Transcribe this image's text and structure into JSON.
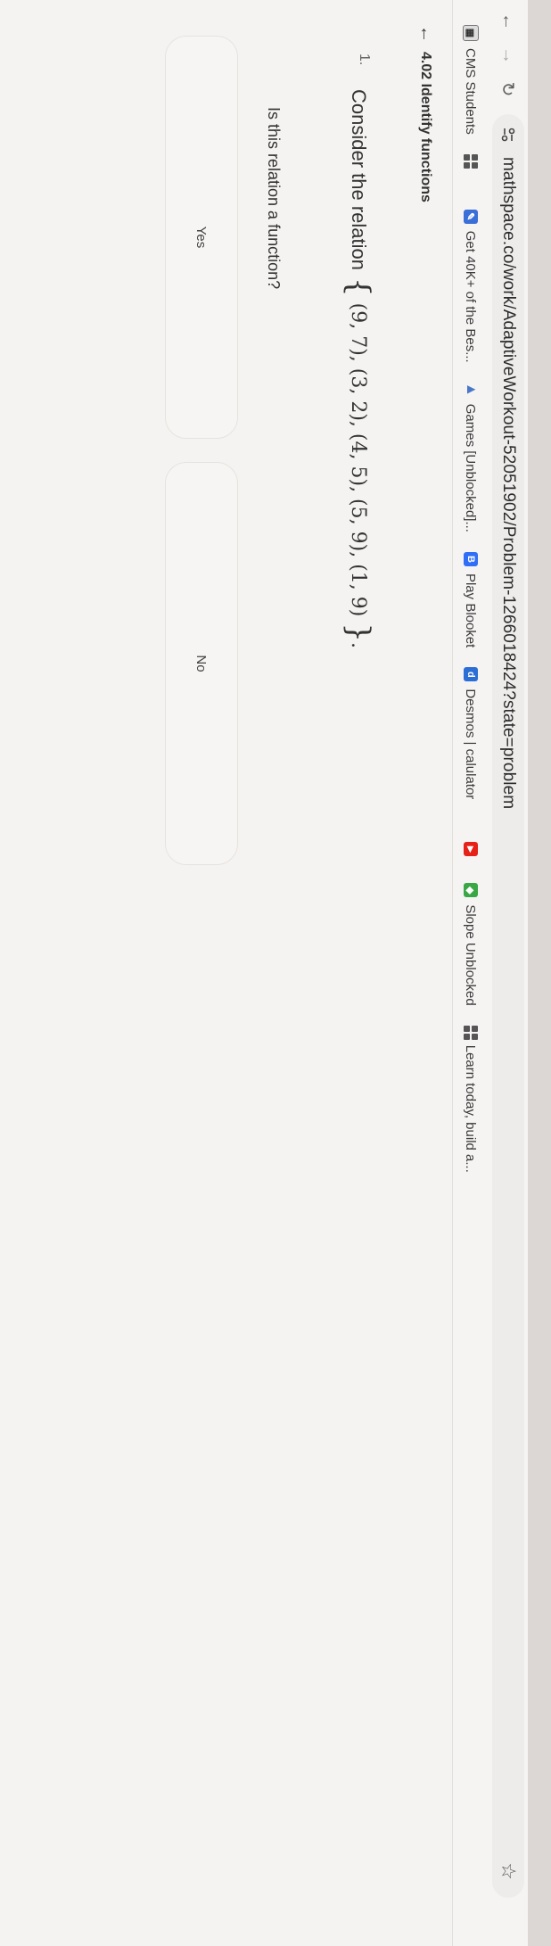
{
  "browser": {
    "url": "mathspace.co/work/AdaptiveWorkout-52051902/Problem-1266018424?state=problem",
    "bookmarks": [
      {
        "label": "CMS Students"
      },
      {
        "label": ""
      },
      {
        "label": "Get 40K+ of the Bes..."
      },
      {
        "label": "Games [Unblocked]..."
      },
      {
        "label": "Play Blooket"
      },
      {
        "label": "Desmos | calulator"
      },
      {
        "label": ""
      },
      {
        "label": "Slope Unblocked"
      },
      {
        "label": "Learn today, build a..."
      }
    ]
  },
  "page": {
    "title": "4.02 Identify functions",
    "question_number": "1.",
    "prompt": "Consider the relation",
    "relation": "(9, 7), (3, 2), (4, 5), (5, 9), (1, 9)",
    "sub_question": "Is this relation a function?",
    "options": [
      "Yes",
      "No"
    ]
  },
  "colors": {
    "accent": "#4a5cc7",
    "blooket": "#2f6ef5",
    "desmos": "#2a6ed6",
    "youtube": "#e62117"
  }
}
